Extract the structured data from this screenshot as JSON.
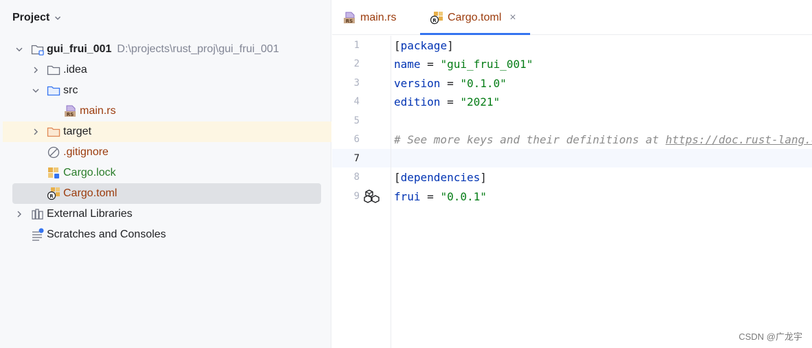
{
  "project_panel": {
    "title": "Project",
    "tree": [
      {
        "label": "gui_frui_001",
        "path": "D:\\projects\\rust_proj\\gui_frui_001",
        "icon": "module-folder-icon"
      },
      {
        "label": ".idea",
        "icon": "folder-icon"
      },
      {
        "label": "src",
        "icon": "source-folder-icon"
      },
      {
        "label": "main.rs",
        "icon": "rust-file-icon"
      },
      {
        "label": "target",
        "icon": "excluded-folder-icon"
      },
      {
        "label": ".gitignore",
        "icon": "ignore-file-icon"
      },
      {
        "label": "Cargo.lock",
        "icon": "cargo-lock-icon"
      },
      {
        "label": "Cargo.toml",
        "icon": "cargo-toml-icon"
      },
      {
        "label": "External Libraries",
        "icon": "library-icon"
      },
      {
        "label": "Scratches and Consoles",
        "icon": "scratches-icon"
      }
    ]
  },
  "editor": {
    "tabs": [
      {
        "label": "main.rs",
        "icon": "rust-file-icon",
        "active": false
      },
      {
        "label": "Cargo.toml",
        "icon": "cargo-toml-icon",
        "active": true,
        "close": "×"
      }
    ],
    "lines": [
      {
        "num": "1",
        "tokens": {
          "open": "[",
          "name": "package",
          "close": "]"
        }
      },
      {
        "num": "2",
        "tokens": {
          "key": "name",
          "eq": " = ",
          "val": "\"gui_frui_001\""
        }
      },
      {
        "num": "3",
        "tokens": {
          "key": "version",
          "eq": " = ",
          "val": "\"0.1.0\""
        }
      },
      {
        "num": "4",
        "tokens": {
          "key": "edition",
          "eq": " = ",
          "val": "\"2021\""
        }
      },
      {
        "num": "5"
      },
      {
        "num": "6",
        "tokens": {
          "comment": "# See more keys and their definitions at ",
          "link": "https://doc.rust-lang.org/cargo/reference/manifest.html"
        }
      },
      {
        "num": "7"
      },
      {
        "num": "8",
        "tokens": {
          "open": "[",
          "name": "dependencies",
          "close": "]"
        }
      },
      {
        "num": "9",
        "tokens": {
          "key": "frui",
          "eq": " = ",
          "val": "\"0.0.1\""
        }
      }
    ]
  },
  "watermark": "CSDN @广龙宇",
  "colors": {
    "accent": "#3574f0",
    "keyword": "#0033b3",
    "string": "#067d17",
    "comment": "#8c8c8c",
    "rust_file": "#9b3b0c",
    "lock_file": "#2a7d2a"
  }
}
